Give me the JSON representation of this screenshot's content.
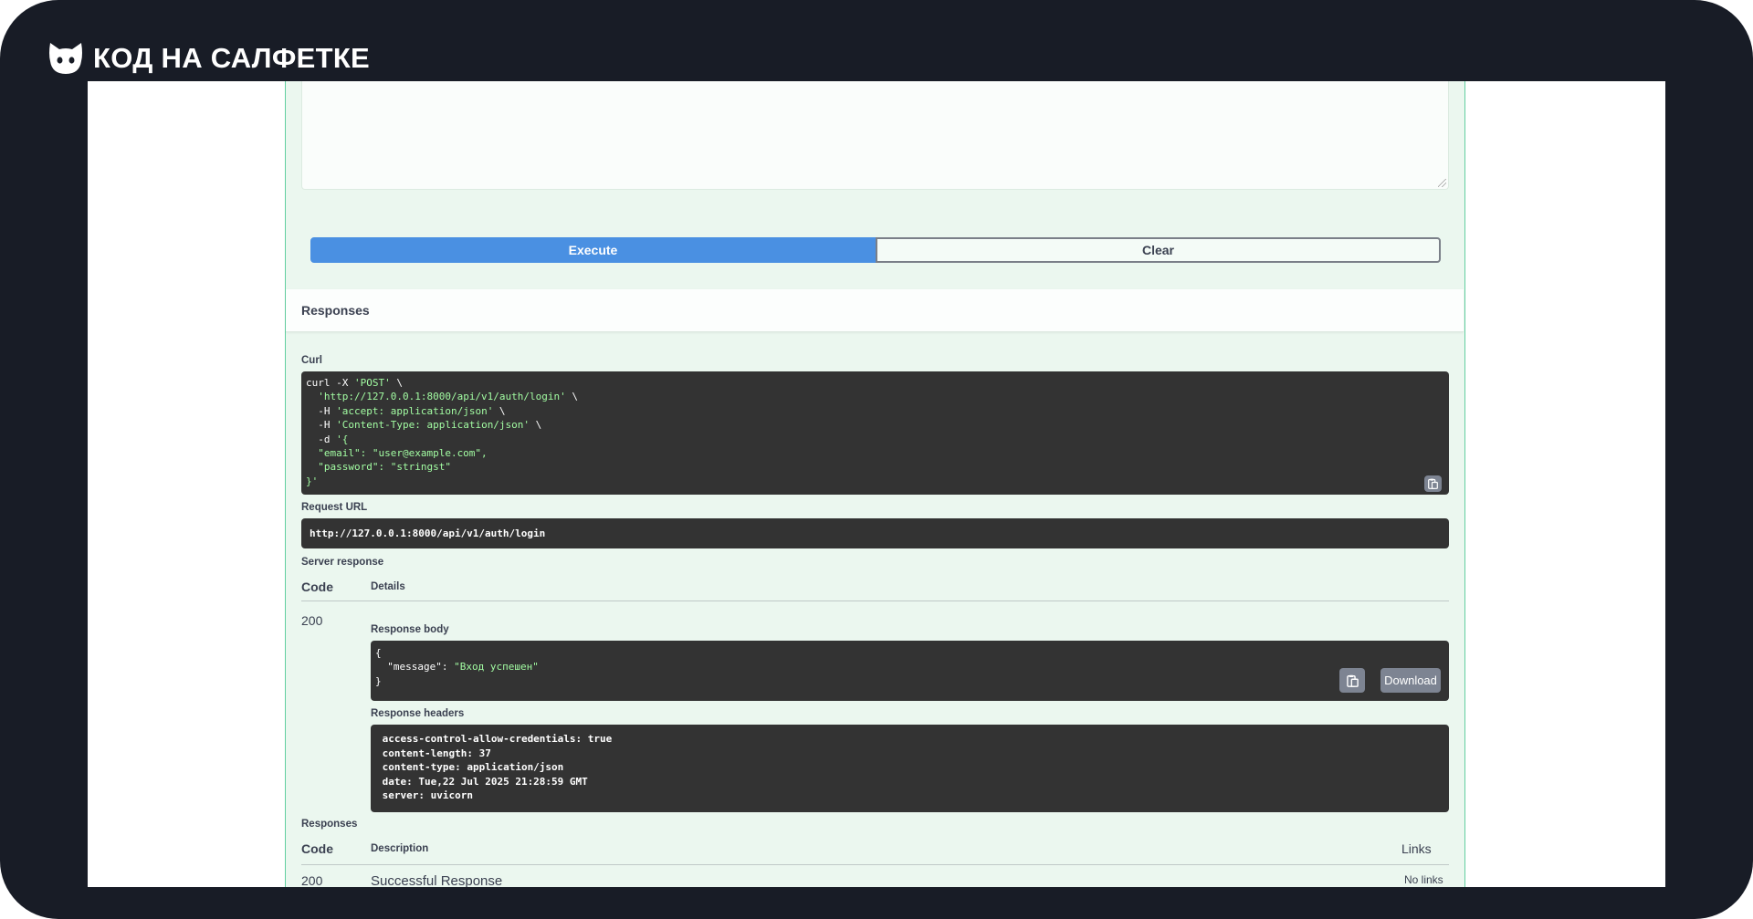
{
  "brand": {
    "name": "КОД НА САЛФЕТКЕ"
  },
  "actions": {
    "execute_label": "Execute",
    "clear_label": "Clear"
  },
  "responses_section": {
    "title": "Responses"
  },
  "curl": {
    "label": "Curl",
    "lines": [
      {
        "plain": "curl -X ",
        "str": "'POST'",
        "tail": " \\"
      },
      {
        "plain": "  ",
        "str": "'http://127.0.0.1:8000/api/v1/auth/login'",
        "tail": " \\"
      },
      {
        "plain": "  -H ",
        "str": "'accept: application/json'",
        "tail": " \\"
      },
      {
        "plain": "  -H ",
        "str": "'Content-Type: application/json'",
        "tail": " \\"
      },
      {
        "plain": "  -d ",
        "str": "'{",
        "tail": ""
      },
      {
        "plain": "",
        "str": "  \"email\": \"user@example.com\",",
        "tail": ""
      },
      {
        "plain": "",
        "str": "  \"password\": \"stringst\"",
        "tail": ""
      },
      {
        "plain": "",
        "str": "}'",
        "tail": ""
      }
    ]
  },
  "request_url": {
    "label": "Request URL",
    "value": "http://127.0.0.1:8000/api/v1/auth/login"
  },
  "server_response": {
    "label": "Server response",
    "col_code": "Code",
    "col_details": "Details",
    "code": "200",
    "body_label": "Response body",
    "body_lines": [
      {
        "plain": "{",
        "key": "",
        "str": ""
      },
      {
        "plain": "  ",
        "key": "\"message\": ",
        "str": "\"Вход успешен\""
      },
      {
        "plain": "}",
        "key": "",
        "str": ""
      }
    ],
    "download_label": "Download",
    "headers_label": "Response headers",
    "headers": [
      " access-control-allow-credentials: true ",
      " content-length: 37 ",
      " content-type: application/json ",
      " date: Tue,22 Jul 2025 21:28:59 GMT ",
      " server: uvicorn "
    ]
  },
  "responses_table": {
    "label": "Responses",
    "col_code": "Code",
    "col_description": "Description",
    "col_links": "Links",
    "row": {
      "code": "200",
      "description": "Successful Response",
      "links": "No links"
    }
  },
  "icons": {
    "logo": "cat-head-icon",
    "copy": "clipboard-copy-icon"
  },
  "colors": {
    "frame": "#181c26",
    "execute": "#4a90e2",
    "opblock_bg": "#ebf7ef",
    "opblock_border": "#62cfa0",
    "code_bg": "#333333",
    "code_string": "#a2fca2"
  }
}
